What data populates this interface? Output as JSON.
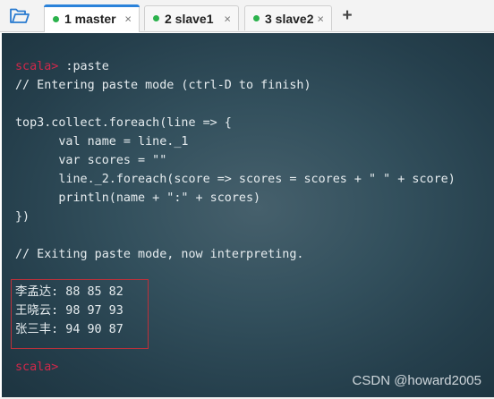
{
  "tabs": [
    {
      "label": "1 master",
      "close": "×"
    },
    {
      "label": "2 slave1",
      "close": "×"
    },
    {
      "label": "3 slave2",
      "close": "×"
    }
  ],
  "add_tab": "+",
  "terminal": {
    "prompt_text": "scala>",
    "paste_cmd": " :paste",
    "lines": {
      "entering": "// Entering paste mode (ctrl-D to finish)",
      "code1": "top3.collect.foreach(line => {",
      "code2": "      val name = line._1",
      "code3": "      var scores = \"\"",
      "code4": "      line._2.foreach(score => scores = scores + \" \" + score)",
      "code5": "      println(name + \":\" + scores)",
      "code6": "})",
      "exiting": "// Exiting paste mode, now interpreting."
    },
    "output": [
      "李孟达: 88 85 82",
      "王晓云: 98 97 93",
      "张三丰: 94 90 87"
    ]
  },
  "watermark": "CSDN @howard2005",
  "colors": {
    "prompt": "#d1284a",
    "active_tab_accent": "#2a82da",
    "status_dot": "#2bb24c",
    "highlight_border": "#c0303a"
  },
  "icons": [
    "folder-open-icon",
    "status-dot-icon",
    "close-icon",
    "plus-icon"
  ]
}
